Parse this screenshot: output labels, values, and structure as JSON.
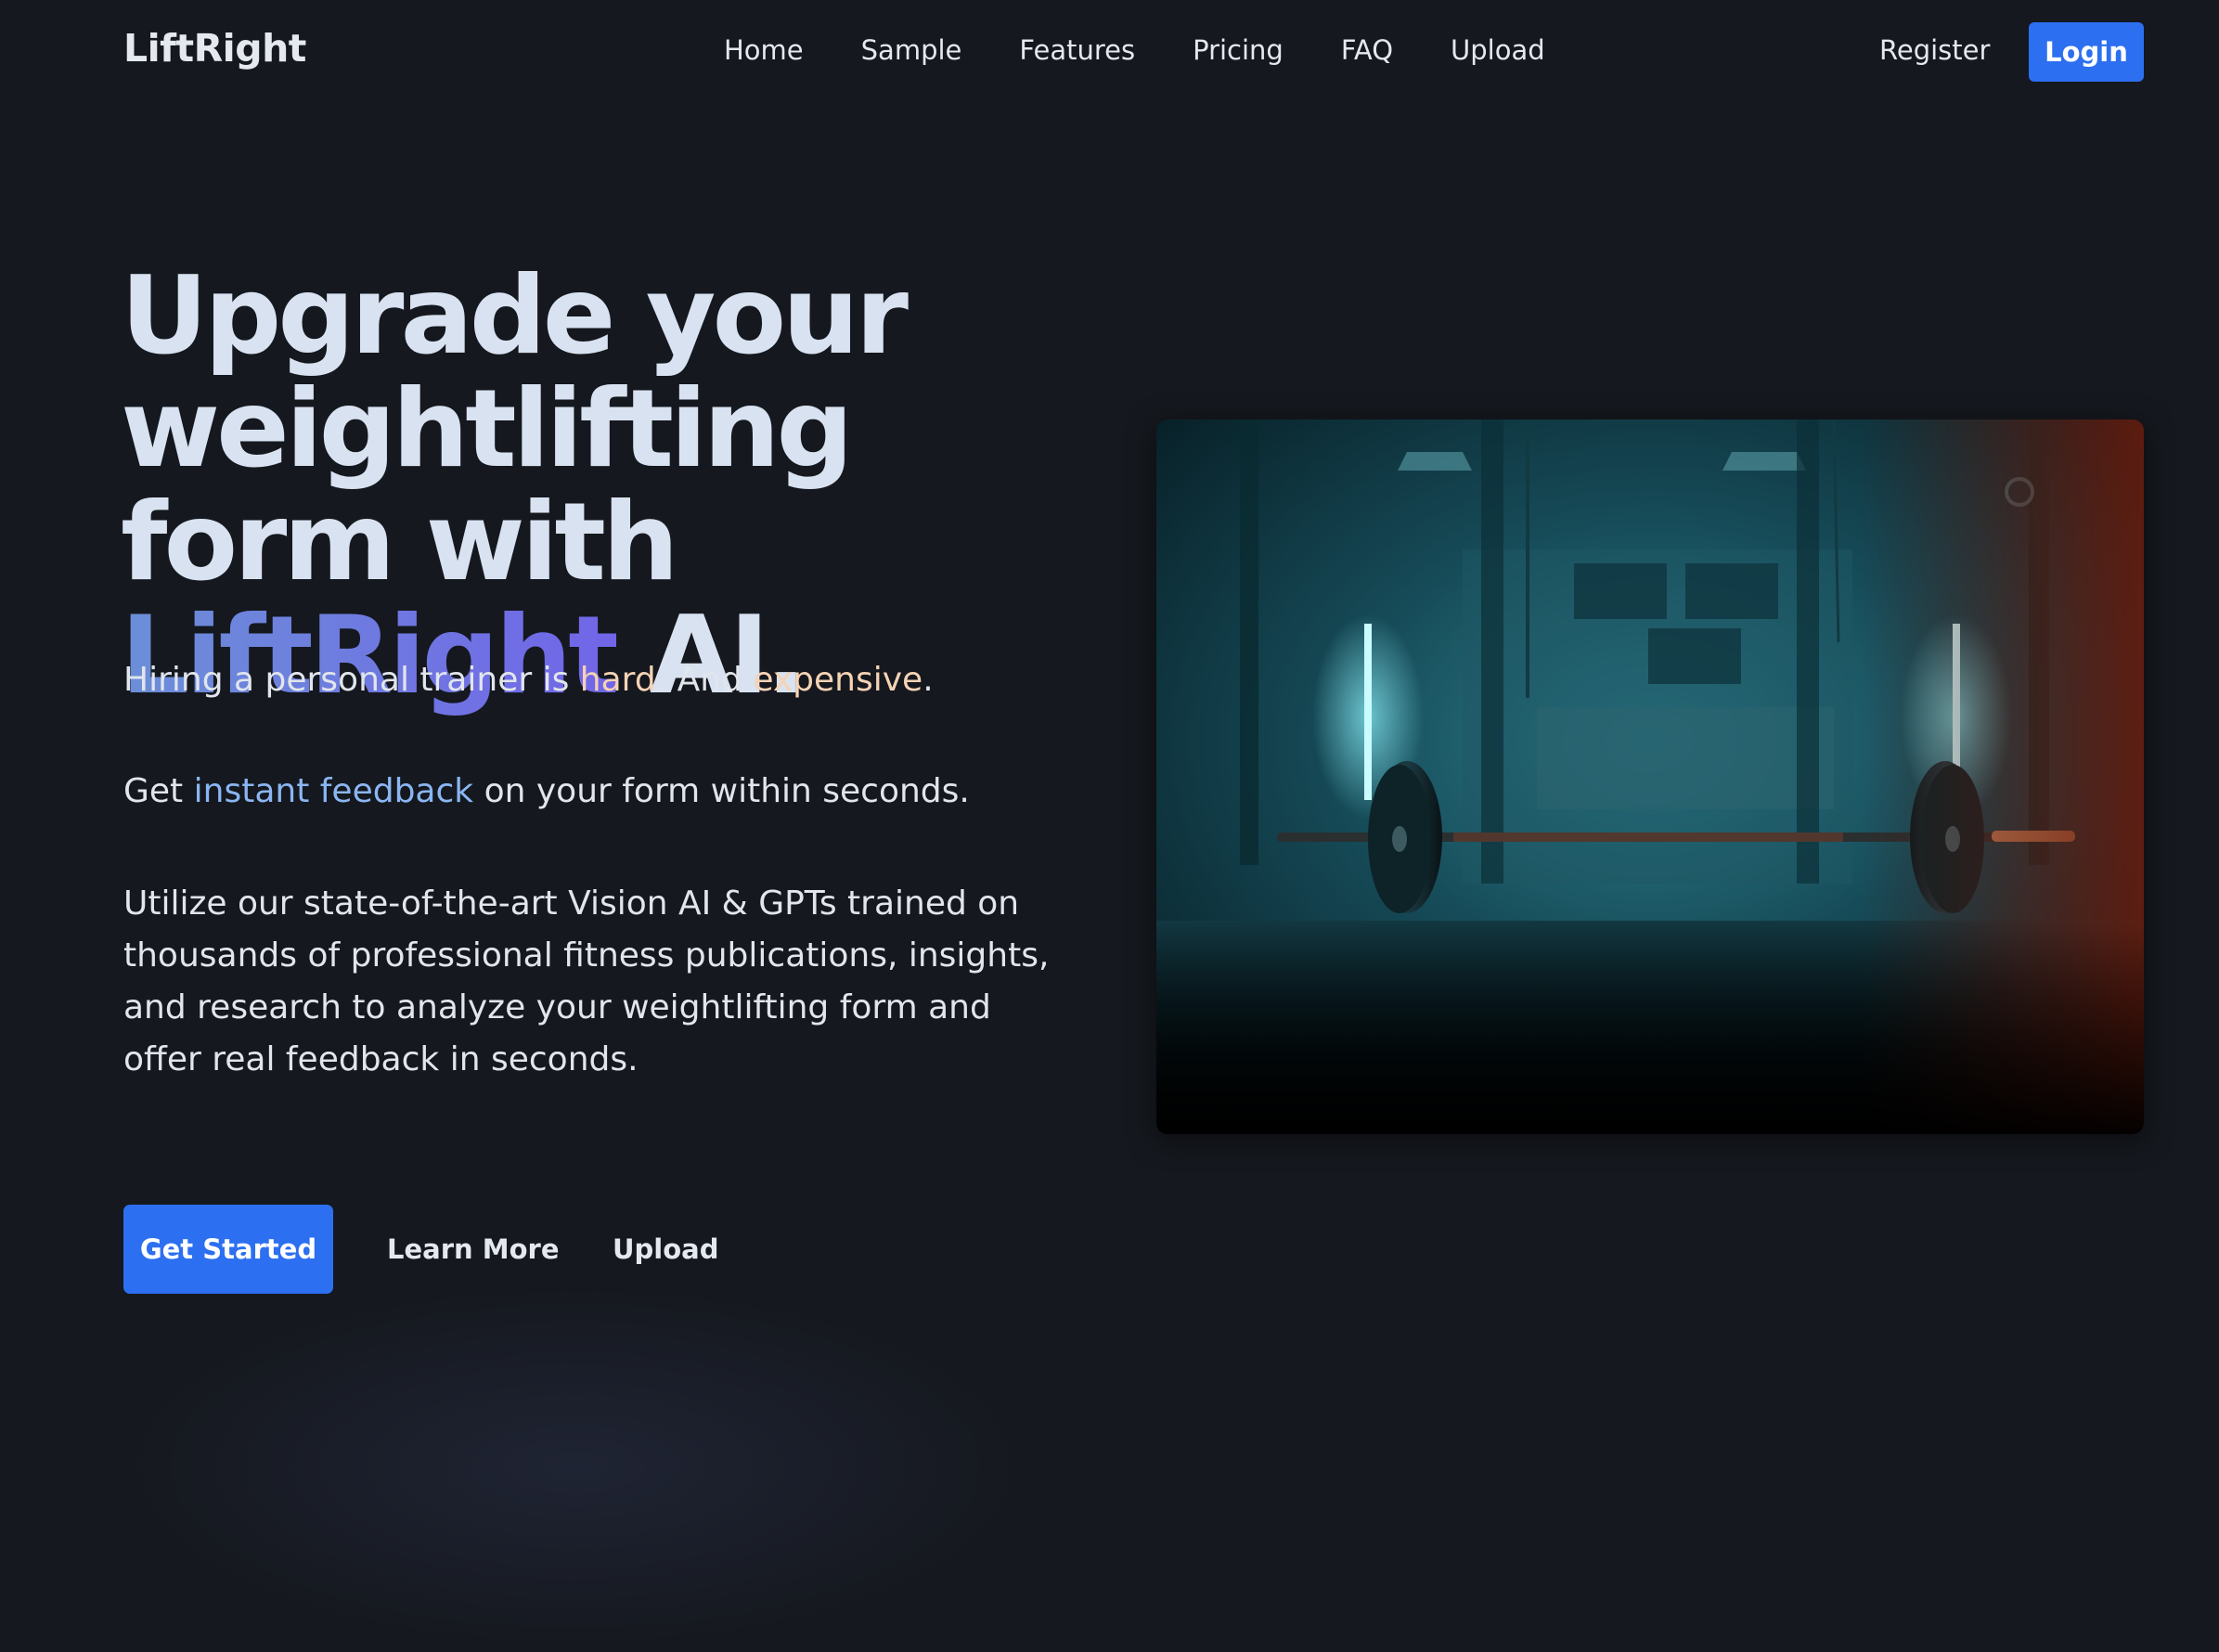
{
  "nav": {
    "logo": "LiftRight",
    "links": [
      "Home",
      "Sample",
      "Features",
      "Pricing",
      "FAQ",
      "Upload"
    ],
    "register": "Register",
    "login": "Login"
  },
  "hero": {
    "title_part1": "Upgrade your weightlifting form with",
    "title_accent": "LiftRight",
    "title_part2": "AI.",
    "p1_start": "Hiring a personal trainer is",
    "p1_hard": "hard",
    "p1_mid": ". And",
    "p1_expensive": "expensive",
    "p1_end": ".",
    "p2_start": "Get",
    "p2_highlight": "instant feedback",
    "p2_end": "on your form within seconds.",
    "p3": "Utilize our state-of-the-art Vision AI & GPTs trained on thousands of professional fitness publications, insights, and research to analyze your weightlifting form and offer real feedback in seconds."
  },
  "cta": {
    "get_started": "Get Started",
    "learn_more": "Learn More",
    "upload": "Upload"
  },
  "colors": {
    "background": "#15181e",
    "primary_button": "#2c6ff0",
    "accent_gradient_start": "#6c8fd8",
    "accent_gradient_end": "#7165e8",
    "highlight_warm": "#f5d3b5",
    "highlight_blue": "#8ab6f2"
  },
  "image": {
    "subject": "barbell-in-dark-gym-photo"
  }
}
